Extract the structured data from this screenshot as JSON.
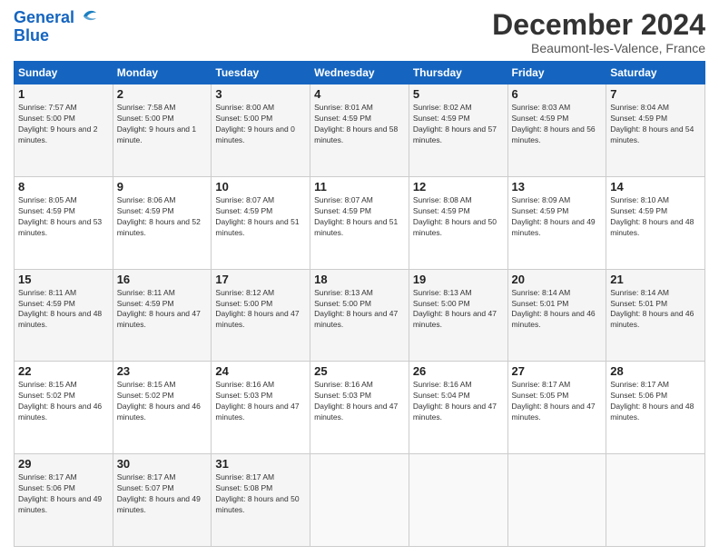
{
  "logo": {
    "line1": "General",
    "line2": "Blue"
  },
  "title": "December 2024",
  "subtitle": "Beaumont-les-Valence, France",
  "days_of_week": [
    "Sunday",
    "Monday",
    "Tuesday",
    "Wednesday",
    "Thursday",
    "Friday",
    "Saturday"
  ],
  "weeks": [
    [
      {
        "day": "1",
        "sunrise": "7:57 AM",
        "sunset": "5:00 PM",
        "daylight": "9 hours and 2 minutes."
      },
      {
        "day": "2",
        "sunrise": "7:58 AM",
        "sunset": "5:00 PM",
        "daylight": "9 hours and 1 minute."
      },
      {
        "day": "3",
        "sunrise": "8:00 AM",
        "sunset": "5:00 PM",
        "daylight": "9 hours and 0 minutes."
      },
      {
        "day": "4",
        "sunrise": "8:01 AM",
        "sunset": "4:59 PM",
        "daylight": "8 hours and 58 minutes."
      },
      {
        "day": "5",
        "sunrise": "8:02 AM",
        "sunset": "4:59 PM",
        "daylight": "8 hours and 57 minutes."
      },
      {
        "day": "6",
        "sunrise": "8:03 AM",
        "sunset": "4:59 PM",
        "daylight": "8 hours and 56 minutes."
      },
      {
        "day": "7",
        "sunrise": "8:04 AM",
        "sunset": "4:59 PM",
        "daylight": "8 hours and 54 minutes."
      }
    ],
    [
      {
        "day": "8",
        "sunrise": "8:05 AM",
        "sunset": "4:59 PM",
        "daylight": "8 hours and 53 minutes."
      },
      {
        "day": "9",
        "sunrise": "8:06 AM",
        "sunset": "4:59 PM",
        "daylight": "8 hours and 52 minutes."
      },
      {
        "day": "10",
        "sunrise": "8:07 AM",
        "sunset": "4:59 PM",
        "daylight": "8 hours and 51 minutes."
      },
      {
        "day": "11",
        "sunrise": "8:07 AM",
        "sunset": "4:59 PM",
        "daylight": "8 hours and 51 minutes."
      },
      {
        "day": "12",
        "sunrise": "8:08 AM",
        "sunset": "4:59 PM",
        "daylight": "8 hours and 50 minutes."
      },
      {
        "day": "13",
        "sunrise": "8:09 AM",
        "sunset": "4:59 PM",
        "daylight": "8 hours and 49 minutes."
      },
      {
        "day": "14",
        "sunrise": "8:10 AM",
        "sunset": "4:59 PM",
        "daylight": "8 hours and 48 minutes."
      }
    ],
    [
      {
        "day": "15",
        "sunrise": "8:11 AM",
        "sunset": "4:59 PM",
        "daylight": "8 hours and 48 minutes."
      },
      {
        "day": "16",
        "sunrise": "8:11 AM",
        "sunset": "4:59 PM",
        "daylight": "8 hours and 47 minutes."
      },
      {
        "day": "17",
        "sunrise": "8:12 AM",
        "sunset": "5:00 PM",
        "daylight": "8 hours and 47 minutes."
      },
      {
        "day": "18",
        "sunrise": "8:13 AM",
        "sunset": "5:00 PM",
        "daylight": "8 hours and 47 minutes."
      },
      {
        "day": "19",
        "sunrise": "8:13 AM",
        "sunset": "5:00 PM",
        "daylight": "8 hours and 47 minutes."
      },
      {
        "day": "20",
        "sunrise": "8:14 AM",
        "sunset": "5:01 PM",
        "daylight": "8 hours and 46 minutes."
      },
      {
        "day": "21",
        "sunrise": "8:14 AM",
        "sunset": "5:01 PM",
        "daylight": "8 hours and 46 minutes."
      }
    ],
    [
      {
        "day": "22",
        "sunrise": "8:15 AM",
        "sunset": "5:02 PM",
        "daylight": "8 hours and 46 minutes."
      },
      {
        "day": "23",
        "sunrise": "8:15 AM",
        "sunset": "5:02 PM",
        "daylight": "8 hours and 46 minutes."
      },
      {
        "day": "24",
        "sunrise": "8:16 AM",
        "sunset": "5:03 PM",
        "daylight": "8 hours and 47 minutes."
      },
      {
        "day": "25",
        "sunrise": "8:16 AM",
        "sunset": "5:03 PM",
        "daylight": "8 hours and 47 minutes."
      },
      {
        "day": "26",
        "sunrise": "8:16 AM",
        "sunset": "5:04 PM",
        "daylight": "8 hours and 47 minutes."
      },
      {
        "day": "27",
        "sunrise": "8:17 AM",
        "sunset": "5:05 PM",
        "daylight": "8 hours and 47 minutes."
      },
      {
        "day": "28",
        "sunrise": "8:17 AM",
        "sunset": "5:06 PM",
        "daylight": "8 hours and 48 minutes."
      }
    ],
    [
      {
        "day": "29",
        "sunrise": "8:17 AM",
        "sunset": "5:06 PM",
        "daylight": "8 hours and 49 minutes."
      },
      {
        "day": "30",
        "sunrise": "8:17 AM",
        "sunset": "5:07 PM",
        "daylight": "8 hours and 49 minutes."
      },
      {
        "day": "31",
        "sunrise": "8:17 AM",
        "sunset": "5:08 PM",
        "daylight": "8 hours and 50 minutes."
      },
      null,
      null,
      null,
      null
    ]
  ],
  "labels": {
    "sunrise": "Sunrise:",
    "sunset": "Sunset:",
    "daylight": "Daylight:"
  }
}
